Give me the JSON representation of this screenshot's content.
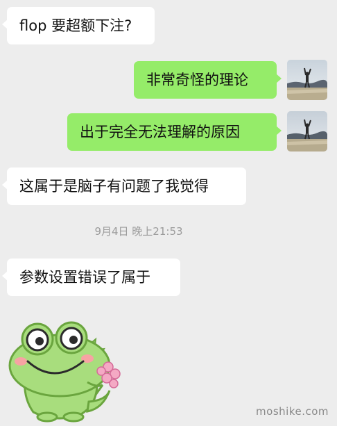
{
  "chat": {
    "messages": [
      {
        "side": "incoming",
        "text": "flop 要超额下注?"
      },
      {
        "side": "outgoing",
        "text": "非常奇怪的理论"
      },
      {
        "side": "outgoing",
        "text": "出于完全无法理解的原因"
      },
      {
        "side": "incoming",
        "text": "这属于是脑子有问题了我觉得"
      },
      {
        "side": "incoming",
        "text": "参数设置错误了属于"
      }
    ],
    "timestamp": "9月4日 晚上21:53",
    "sticker": "green-frog-sticker-holding-flowers"
  },
  "watermark": "moshike.com",
  "colors": {
    "background": "#ededed",
    "incoming_bubble": "#ffffff",
    "outgoing_bubble": "#95ec69",
    "timestamp": "#9b9b9b"
  }
}
